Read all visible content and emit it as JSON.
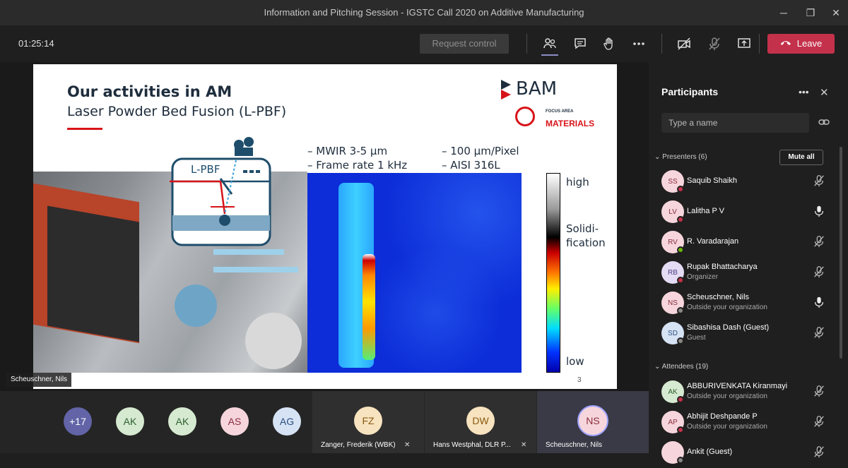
{
  "window": {
    "title": "Information and Pitching Session - IGSTC Call 2020 on Additive Manufacturing",
    "minimize_icon": "minimize-icon",
    "restore_icon": "restore-icon",
    "close_icon": "close-icon"
  },
  "toolbar": {
    "timer": "01:25:14",
    "request_control_label": "Request control",
    "leave_label": "Leave",
    "leave_color": "#c4314b",
    "accent": "#8b8cc7"
  },
  "slide": {
    "title": "Our activities in AM",
    "subtitle": "Laser Powder Bed Fusion (L-PBF)",
    "logo_text": "BAM",
    "focus_area_small": "FOCUS AREA",
    "focus_area_big": "MATERIALS",
    "diagram_label": "L-PBF",
    "specs": [
      "– MWIR 3-5 µm",
      "– Frame rate 1 kHz",
      "– 100 µm/Pixel",
      "– AISI 316L"
    ],
    "colorbar_high": "high",
    "colorbar_mid": "Solidi-\nfication",
    "colorbar_mid_line1": "Solidi-",
    "colorbar_mid_line2": "fication",
    "colorbar_low": "low",
    "page_number": "3",
    "presenter_tag": "Scheuschner, Nils"
  },
  "strip": {
    "overflow": "+17",
    "avatars": [
      "AK",
      "AK",
      "AS",
      "AG"
    ],
    "tiles": [
      {
        "initials": "FZ",
        "name": "Zanger, Frederik (WBK)"
      },
      {
        "initials": "DW",
        "name": "Hans Westphal, DLR P..."
      },
      {
        "initials": "NS",
        "name": "Scheuschner, Nils"
      }
    ]
  },
  "panel": {
    "title": "Participants",
    "search_placeholder": "Type a name",
    "presenters_label": "Presenters (6)",
    "mute_all_label": "Mute all",
    "attendees_label": "Attendees (19)",
    "presenters": [
      {
        "initials": "SS",
        "name": "Saquib Shaikh",
        "sub": "",
        "status": "#c4314b",
        "mic": "muted"
      },
      {
        "initials": "LV",
        "name": "Lalitha P V",
        "sub": "",
        "status": "#c4314b",
        "mic": "on"
      },
      {
        "initials": "RV",
        "name": "R. Varadarajan",
        "sub": "",
        "status": "#6bb700",
        "mic": "muted"
      },
      {
        "initials": "RB",
        "name": "Rupak Bhattacharya",
        "sub": "Organizer",
        "status": "#c4314b",
        "mic": "muted"
      },
      {
        "initials": "NS",
        "name": "Scheuschner, Nils",
        "sub": "Outside your organization",
        "status": "#8a8886",
        "mic": "on"
      },
      {
        "initials": "SD",
        "name": "Sibashisa Dash (Guest)",
        "sub": "Guest",
        "status": "#8a8886",
        "mic": "muted"
      }
    ],
    "attendees": [
      {
        "initials": "AK",
        "name": "ABBURIVENKATA Kiranmayi",
        "sub": "Outside your organization",
        "status": "#c4314b",
        "mic": "muted"
      },
      {
        "initials": "AP",
        "name": "Abhijit Deshpande P",
        "sub": "Outside your organization",
        "status": "#c4314b",
        "mic": "muted"
      },
      {
        "initials": "",
        "name": "Ankit (Guest)",
        "sub": "",
        "status": "#8a8886",
        "mic": "muted"
      }
    ]
  }
}
